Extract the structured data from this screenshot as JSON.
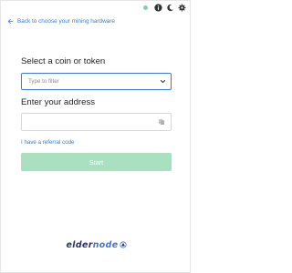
{
  "window_controls": {
    "status_color": "#7dd3a8",
    "icons": [
      "info-icon",
      "moon-icon",
      "settings-icon"
    ]
  },
  "navigation": {
    "back_label": "Back to choose your mining hardware"
  },
  "coin_section": {
    "title": "Select a coin or token",
    "placeholder": "Type to filter"
  },
  "address_section": {
    "title": "Enter your address",
    "value": "",
    "paste_icon": "paste-icon"
  },
  "referral": {
    "label": "I have a referral code"
  },
  "actions": {
    "start_label": "Start"
  },
  "watermark": {
    "text_dark": "elder",
    "text_accent": "node",
    "logo": "eldernode-logo"
  },
  "colors": {
    "link": "#3a7bd5",
    "start_button_disabled": "#a8e0c0",
    "brand_dark": "#2c2f6b",
    "brand_accent": "#3f74d8"
  }
}
